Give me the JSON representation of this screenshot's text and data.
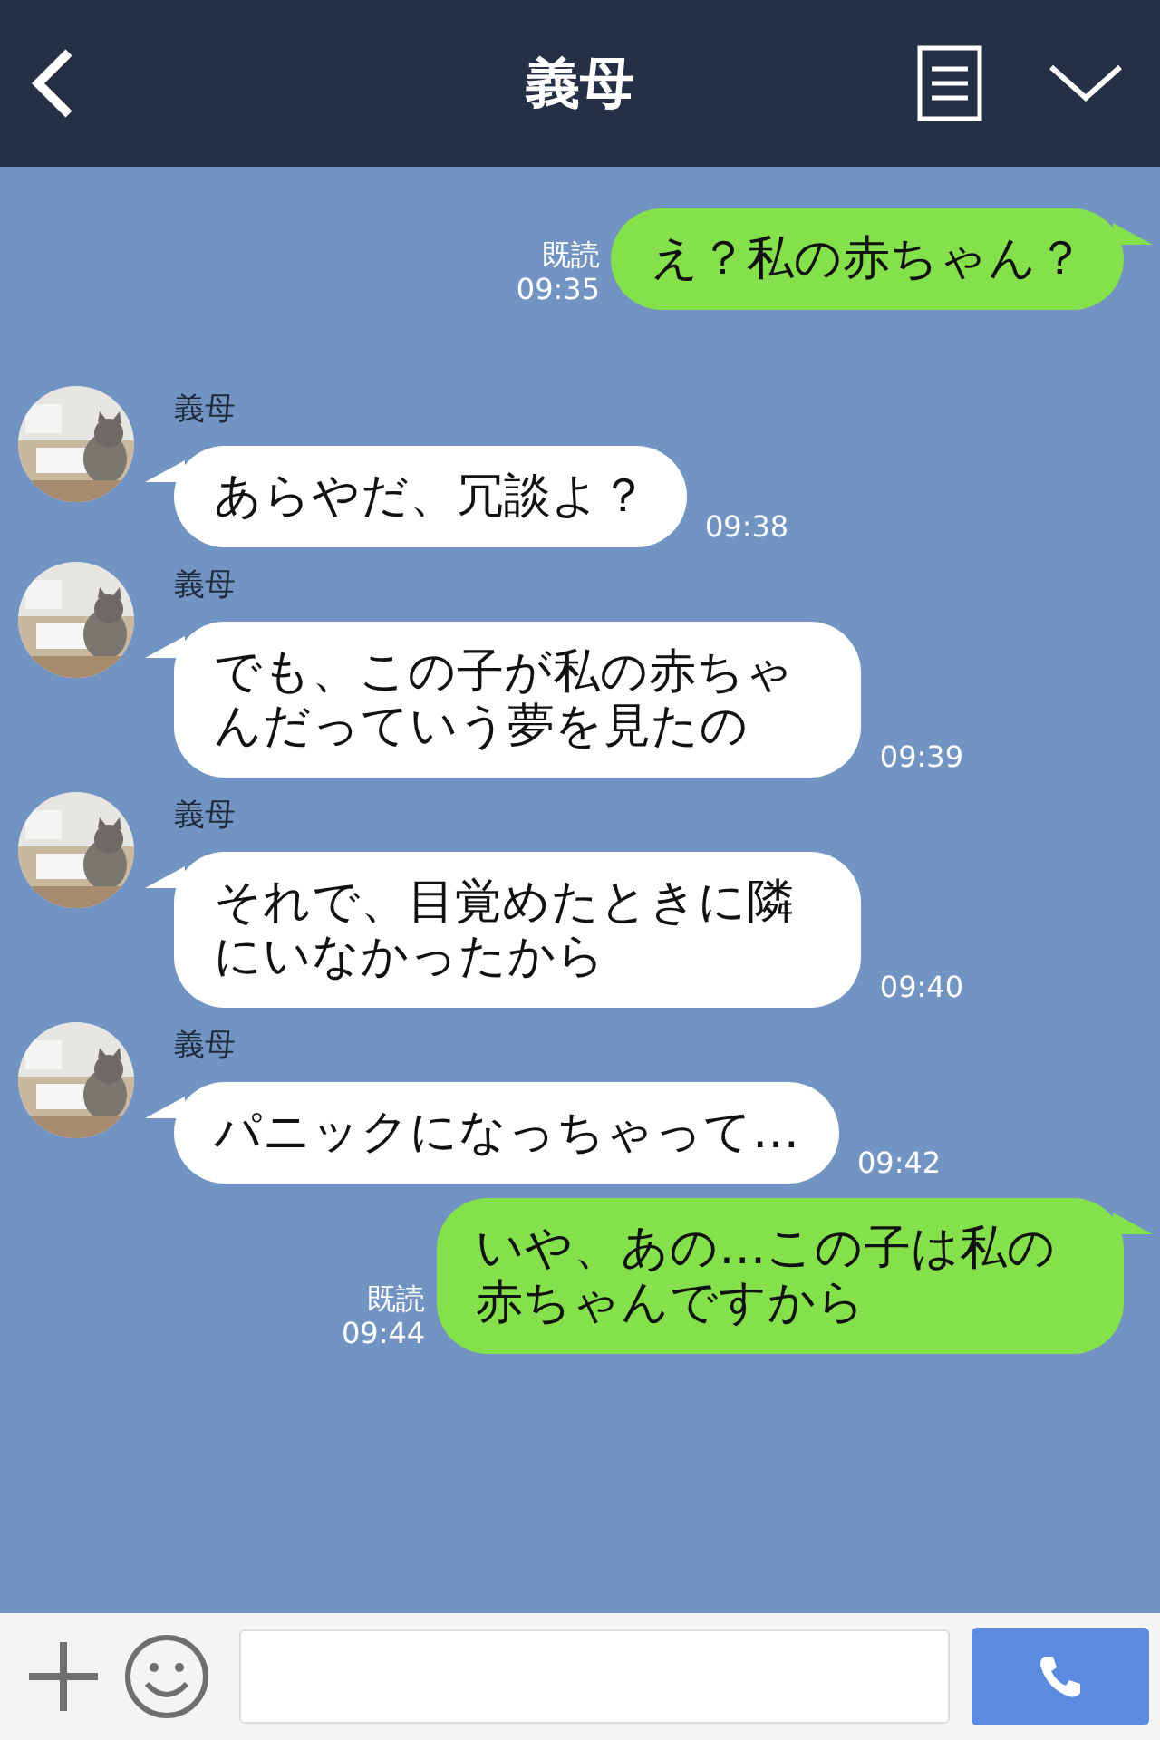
{
  "header": {
    "title": "義母"
  },
  "messages": [
    {
      "kind": "sent",
      "text": "え？私の赤ちゃん？",
      "read": "既読",
      "time": "09:35"
    },
    {
      "kind": "received",
      "name": "義母",
      "text": "あらやだ、冗談よ？",
      "time": "09:38"
    },
    {
      "kind": "received",
      "name": "義母",
      "text": "でも、この子が私の赤ちゃんだっていう夢を見たの",
      "time": "09:39"
    },
    {
      "kind": "received",
      "name": "義母",
      "text": "それで、目覚めたときに隣にいなかったから",
      "time": "09:40"
    },
    {
      "kind": "received",
      "name": "義母",
      "text": "パニックになっちゃって…",
      "time": "09:42"
    },
    {
      "kind": "sent",
      "text": "いや、あの…この子は私の赤ちゃんですから",
      "read": "既読",
      "time": "09:44"
    }
  ]
}
